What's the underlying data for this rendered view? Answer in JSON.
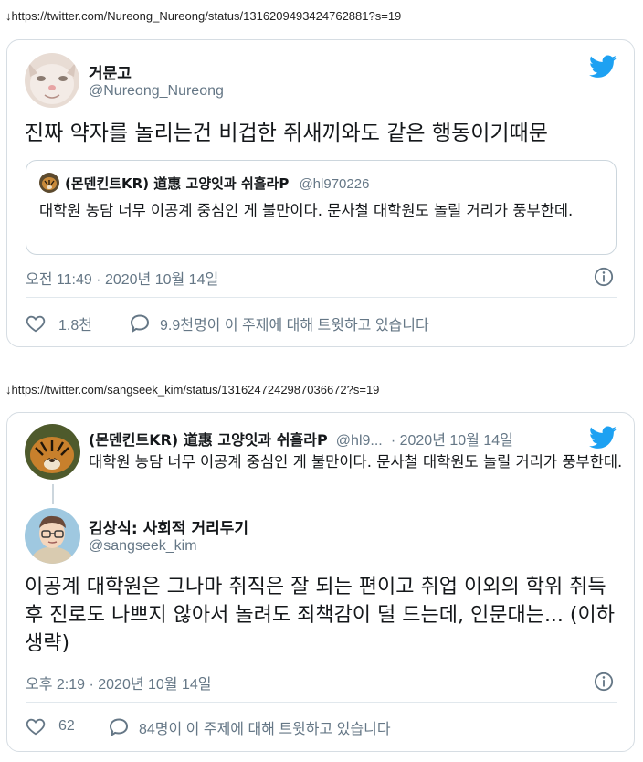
{
  "tweet1": {
    "url": "↓https://twitter.com/Nureong_Nureong/status/1316209493424762881?s=19",
    "author": {
      "name": "거문고",
      "handle": "@Nureong_Nureong"
    },
    "text": "진짜 약자를 놀리는건 비겁한 쥐새끼와도 같은 행동이기때문",
    "quoted": {
      "name": "(몬덴킨트KR) 道惠 고양잇과 쉬흘라P",
      "handle": "@hl970226",
      "text": "대학원 농담 너무 이공계 중심인 게 불만이다. 문사철 대학원도 놀릴 거리가 풍부한데."
    },
    "timestamp": "오전 11:49 · 2020년 10월 14일",
    "likes": "1.8천",
    "conversation": "9.9천명이 이 주제에 대해 트윗하고 있습니다"
  },
  "tweet2": {
    "url": "↓https://twitter.com/sangseek_kim/status/1316247242987036672?s=19",
    "parent": {
      "name": "(몬덴킨트KR) 道惠 고양잇과 쉬흘라P",
      "handle": "@hl9...",
      "date": "· 2020년 10월 14일",
      "text": "대학원 농담 너무 이공계 중심인 게 불만이다. 문사철 대학원도 놀릴 거리가 풍부한데."
    },
    "author": {
      "name": "김상식: 사회적 거리두기",
      "handle": "@sangseek_kim"
    },
    "text": "이공계 대학원은 그나마 취직은 잘 되는 편이고 취업 이외의 학위 취득후 진로도 나쁘지 않아서 놀려도 죄책감이 덜 드는데, 인문대는... (이하생략)",
    "timestamp": "오후 2:19 · 2020년 10월 14일",
    "likes": "62",
    "conversation": "84명이 이 주제에 대해 트윗하고 있습니다"
  },
  "colors": {
    "twitter_blue": "#1da1f2",
    "secondary_text": "#657786",
    "border": "#d6dde3"
  },
  "icons": [
    "twitter-bird-icon",
    "info-icon",
    "heart-icon",
    "speech-bubble-icon"
  ]
}
